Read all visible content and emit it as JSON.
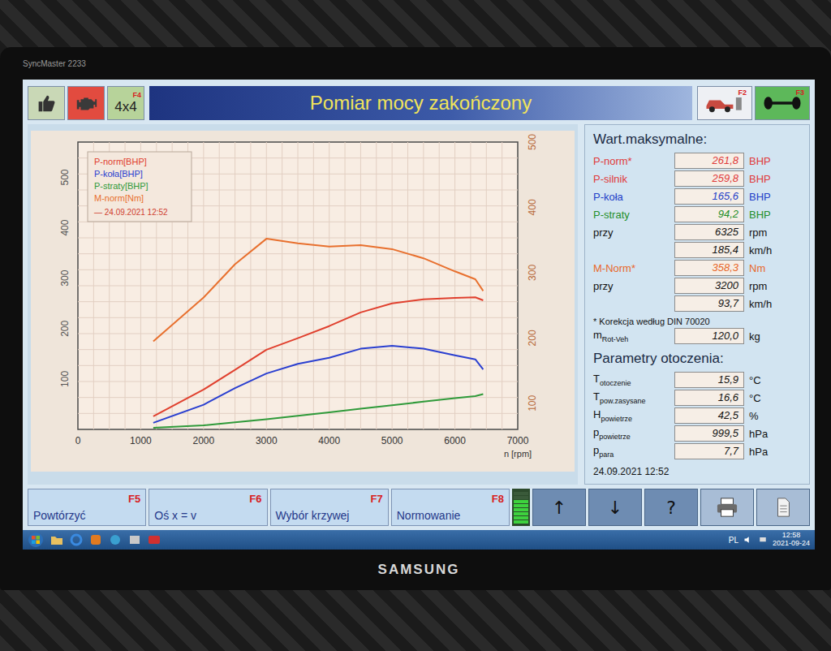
{
  "monitor": {
    "model": "SyncMaster 2233",
    "brand": "SAMSUNG"
  },
  "toolbar": {
    "left": [
      {
        "kind": "thumb"
      },
      {
        "kind": "engine"
      },
      {
        "kind": "key",
        "key": "F4",
        "label": "4x4"
      }
    ],
    "right": [
      {
        "kind": "car",
        "key": "F2"
      },
      {
        "kind": "axle",
        "key": "F3"
      }
    ]
  },
  "title": "Pomiar mocy zakończony",
  "chart": {
    "x_ticks": [
      "0",
      "1000",
      "2000",
      "3000",
      "4000",
      "5000",
      "6000",
      "7000"
    ],
    "x_label": "n [rpm]",
    "left_ticks": [
      "100",
      "200",
      "300",
      "400",
      "500"
    ],
    "right_ticks": [
      "100",
      "200",
      "300",
      "400",
      "500"
    ],
    "legend_date": "— 24.09.2021 12:52",
    "rpm": [
      1200,
      2000,
      2500,
      3000,
      3500,
      4000,
      4500,
      5000,
      5500,
      6000,
      6325,
      6450
    ],
    "series": [
      {
        "name": "P-norm[BHP]",
        "axis": "power",
        "color": "#e0402e",
        "values": [
          26,
          79,
          118,
          158,
          181,
          205,
          232,
          250,
          258,
          261,
          262,
          256
        ]
      },
      {
        "name": "P-koła[BHP]",
        "axis": "power",
        "color": "#2a3fd0",
        "values": [
          13,
          49,
          82,
          111,
          130,
          142,
          160,
          166,
          160,
          147,
          139,
          119
        ]
      },
      {
        "name": "P-straty[BHP]",
        "axis": "power",
        "color": "#2f9a3a",
        "values": [
          3,
          8,
          14,
          20,
          27,
          34,
          41,
          48,
          55,
          62,
          66,
          70
        ]
      },
      {
        "name": "M-norm[Nm]",
        "axis": "torque",
        "color": "#e8702e",
        "values": [
          195,
          262,
          313,
          352,
          345,
          340,
          342,
          336,
          322,
          302,
          290,
          272
        ]
      }
    ]
  },
  "max_values": {
    "title": "Wart.maksymalne:",
    "rows": [
      {
        "label": "P-norm*",
        "value": "261,8",
        "unit": "BHP",
        "color": "#e03a3a"
      },
      {
        "label": "P-silnik",
        "value": "259,8",
        "unit": "BHP",
        "color": "#e03a3a"
      },
      {
        "label": "P-koła",
        "value": "165,6",
        "unit": "BHP",
        "color": "#2340c8"
      },
      {
        "label": "P-straty",
        "value": "94,2",
        "unit": "BHP",
        "color": "#1f8f2a"
      },
      {
        "label": "przy",
        "value": "6325",
        "unit": "rpm",
        "color": "#111111"
      },
      {
        "value": "185,4",
        "unit": "km/h",
        "color": "#111111"
      },
      {
        "label": "M-Norm*",
        "value": "358,3",
        "unit": "Nm",
        "color": "#e8682a"
      },
      {
        "label": "przy",
        "value": "3200",
        "unit": "rpm",
        "color": "#111111"
      },
      {
        "value": "93,7",
        "unit": "km/h",
        "color": "#111111"
      }
    ],
    "note": "* Korekcja według DIN 70020",
    "mass": {
      "label": "m",
      "sub": "Rot-Veh",
      "value": "120,0",
      "unit": "kg"
    }
  },
  "ambient": {
    "title": "Parametry otoczenia:",
    "rows": [
      {
        "label": "T",
        "sub": "otoczenie",
        "value": "15,9",
        "unit": "°C"
      },
      {
        "label": "T",
        "sub": "pow.zasysane",
        "value": "16,6",
        "unit": "°C"
      },
      {
        "label": "H",
        "sub": "powietrze",
        "value": "42,5",
        "unit": "%"
      },
      {
        "label": "p",
        "sub": "powietrze",
        "value": "999,5",
        "unit": "hPa"
      },
      {
        "label": "p",
        "sub": "para",
        "value": "7,7",
        "unit": "hPa"
      }
    ]
  },
  "date": "24.09.2021  12:52",
  "buttons": [
    {
      "label": "Powtórzyć",
      "key": "F5"
    },
    {
      "label": "Oś x = v",
      "key": "F6"
    },
    {
      "label": "Wybór krzywej",
      "key": "F7"
    },
    {
      "label": "Normowanie",
      "key": "F8"
    }
  ],
  "indicator": {
    "level": 0.8
  },
  "nav_buttons": [
    "↑",
    "↓",
    "?"
  ],
  "taskbar": {
    "lang": "PL",
    "time": "12:58",
    "date": "2021-09-24"
  }
}
